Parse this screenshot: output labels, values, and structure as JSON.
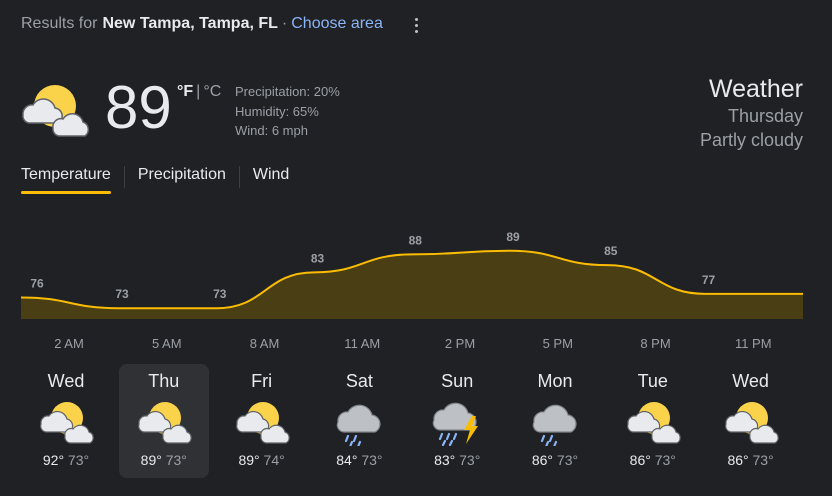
{
  "header": {
    "results_for": "Results for",
    "location": "New Tampa, Tampa, FL",
    "separator": "·",
    "choose_area": "Choose area"
  },
  "current": {
    "icon": "partly-cloudy-icon",
    "temperature": "89",
    "unit_f": "°F",
    "unit_bar": "|",
    "unit_c": "°C",
    "precipitation": "Precipitation: 20%",
    "humidity": "Humidity: 65%",
    "wind": "Wind: 6 mph",
    "title": "Weather",
    "day": "Thursday",
    "condition": "Partly cloudy"
  },
  "tabs": [
    {
      "label": "Temperature",
      "active": true
    },
    {
      "label": "Precipitation",
      "active": false
    },
    {
      "label": "Wind",
      "active": false
    }
  ],
  "colors": {
    "background": "#202124",
    "accent": "#fbbc04",
    "area_fill": "#4a3f14",
    "text_primary": "#e8eaed",
    "text_secondary": "#9aa0a6",
    "link": "#8ab4f8",
    "selected_card": "#303134"
  },
  "chart_data": {
    "type": "area",
    "hours": [
      "2 AM",
      "5 AM",
      "8 AM",
      "11 AM",
      "2 PM",
      "5 PM",
      "8 PM",
      "11 PM"
    ],
    "x_hours": [
      0,
      3,
      6,
      9,
      12,
      15,
      18,
      21,
      24
    ],
    "curve_values": [
      76,
      73,
      73,
      83,
      88,
      89,
      85,
      77,
      77
    ],
    "labels": [
      "76",
      "73",
      "73",
      "83",
      "88",
      "89",
      "85",
      "77"
    ],
    "grid": false
  },
  "forecast": [
    {
      "day": "Wed",
      "icon": "partly-cloudy-icon",
      "high": "92°",
      "low": "73°",
      "selected": false
    },
    {
      "day": "Thu",
      "icon": "partly-cloudy-icon",
      "high": "89°",
      "low": "73°",
      "selected": true
    },
    {
      "day": "Fri",
      "icon": "partly-cloudy-icon",
      "high": "89°",
      "low": "74°",
      "selected": false
    },
    {
      "day": "Sat",
      "icon": "rain-icon",
      "high": "84°",
      "low": "73°",
      "selected": false
    },
    {
      "day": "Sun",
      "icon": "thunderstorm-icon",
      "high": "83°",
      "low": "73°",
      "selected": false
    },
    {
      "day": "Mon",
      "icon": "rain-icon",
      "high": "86°",
      "low": "73°",
      "selected": false
    },
    {
      "day": "Tue",
      "icon": "partly-cloudy-icon",
      "high": "86°",
      "low": "73°",
      "selected": false
    },
    {
      "day": "Wed",
      "icon": "partly-cloudy-icon",
      "high": "86°",
      "low": "73°",
      "selected": false
    }
  ]
}
